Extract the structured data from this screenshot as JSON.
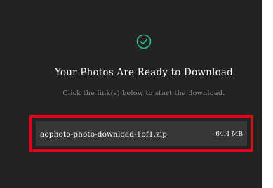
{
  "header": {
    "icon": "check-circle-icon",
    "title": "Your Photos Are Ready to Download",
    "subtitle": "Click the link(s) below to start the download."
  },
  "download": {
    "file_name": "aophoto-photo-download-1of1.zip",
    "file_size": "64.4 MB",
    "highlight_color": "#e2001a"
  },
  "colors": {
    "background": "#232323",
    "row_background": "#363636",
    "accent": "#2fbf8f",
    "text": "#ffffff",
    "muted_text": "#8e8e8e"
  }
}
